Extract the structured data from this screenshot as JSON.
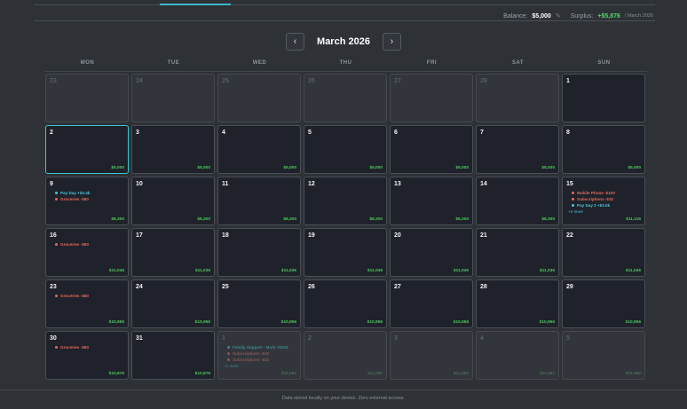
{
  "balance_bar": {
    "balance_label": "Balance:",
    "balance_value": "$5,000",
    "surplus_label": "Surplus:",
    "surplus_value": "+$5,876",
    "surplus_period": "/ March 2026"
  },
  "nav": {
    "prev": "‹",
    "title": "March 2026",
    "next": "›"
  },
  "weekdays": [
    "MON",
    "TUE",
    "WED",
    "THU",
    "FRI",
    "SAT",
    "SUN"
  ],
  "days": [
    {
      "day": "23",
      "out": true,
      "balance": "",
      "events": []
    },
    {
      "day": "24",
      "out": true,
      "balance": "",
      "events": []
    },
    {
      "day": "25",
      "out": true,
      "balance": "",
      "events": []
    },
    {
      "day": "26",
      "out": true,
      "balance": "",
      "events": []
    },
    {
      "day": "27",
      "out": true,
      "balance": "",
      "events": []
    },
    {
      "day": "28",
      "out": true,
      "balance": "",
      "events": []
    },
    {
      "day": "1",
      "balance": "",
      "events": []
    },
    {
      "day": "2",
      "today": true,
      "balance": "$5,000",
      "events": []
    },
    {
      "day": "3",
      "balance": "$5,000",
      "events": []
    },
    {
      "day": "4",
      "balance": "$5,000",
      "events": []
    },
    {
      "day": "5",
      "balance": "$5,000",
      "events": []
    },
    {
      "day": "6",
      "balance": "$5,000",
      "events": []
    },
    {
      "day": "7",
      "balance": "$5,000",
      "events": []
    },
    {
      "day": "8",
      "balance": "$5,000",
      "events": []
    },
    {
      "day": "9",
      "balance": "$8,300",
      "events": [
        {
          "kind": "income",
          "label": "Pay Day +$3.4k"
        },
        {
          "kind": "expense",
          "label": "Groceries -$80"
        }
      ]
    },
    {
      "day": "10",
      "balance": "$8,300",
      "events": []
    },
    {
      "day": "11",
      "balance": "$8,300",
      "events": []
    },
    {
      "day": "12",
      "balance": "$8,300",
      "events": []
    },
    {
      "day": "13",
      "balance": "$8,300",
      "events": []
    },
    {
      "day": "14",
      "balance": "$8,300",
      "events": []
    },
    {
      "day": "15",
      "balance": "$11,116",
      "more": "+2 more",
      "events": [
        {
          "kind": "expense",
          "label": "Mobile Phone -$100"
        },
        {
          "kind": "expense",
          "label": "Subscriptions -$32"
        },
        {
          "kind": "income",
          "label": "Pay Day 2 +$3.0k"
        }
      ]
    },
    {
      "day": "16",
      "balance": "$11,036",
      "events": [
        {
          "kind": "expense",
          "label": "Groceries -$80"
        }
      ]
    },
    {
      "day": "17",
      "balance": "$11,036",
      "events": []
    },
    {
      "day": "18",
      "balance": "$11,036",
      "events": []
    },
    {
      "day": "19",
      "balance": "$11,036",
      "events": []
    },
    {
      "day": "20",
      "balance": "$11,036",
      "events": []
    },
    {
      "day": "21",
      "balance": "$11,036",
      "events": []
    },
    {
      "day": "22",
      "balance": "$11,036",
      "events": []
    },
    {
      "day": "23",
      "balance": "$10,956",
      "events": [
        {
          "kind": "expense",
          "label": "Groceries -$80"
        }
      ]
    },
    {
      "day": "24",
      "balance": "$10,956",
      "events": []
    },
    {
      "day": "25",
      "balance": "$10,956",
      "events": []
    },
    {
      "day": "26",
      "balance": "$10,956",
      "events": []
    },
    {
      "day": "27",
      "balance": "$10,956",
      "events": []
    },
    {
      "day": "28",
      "balance": "$10,956",
      "events": []
    },
    {
      "day": "29",
      "balance": "$10,956",
      "events": []
    },
    {
      "day": "30",
      "balance": "$10,876",
      "events": [
        {
          "kind": "expense",
          "label": "Groceries -$80"
        }
      ]
    },
    {
      "day": "31",
      "balance": "$10,876",
      "events": []
    },
    {
      "day": "1",
      "out": true,
      "balance": "$11,082",
      "more": "+1 more",
      "events": [
        {
          "kind": "income",
          "label": "Family Support - Mark +$206"
        },
        {
          "kind": "expense",
          "label": "Subscriptions -$32"
        },
        {
          "kind": "expense",
          "label": "Subscriptions -$32"
        }
      ]
    },
    {
      "day": "2",
      "out": true,
      "balance": "$11,082",
      "events": []
    },
    {
      "day": "3",
      "out": true,
      "balance": "$11,082",
      "events": []
    },
    {
      "day": "4",
      "out": true,
      "balance": "$11,082",
      "events": []
    },
    {
      "day": "5",
      "out": true,
      "balance": "$11,082",
      "events": []
    }
  ],
  "footer": "Data stored locally on your device. Zero external access."
}
